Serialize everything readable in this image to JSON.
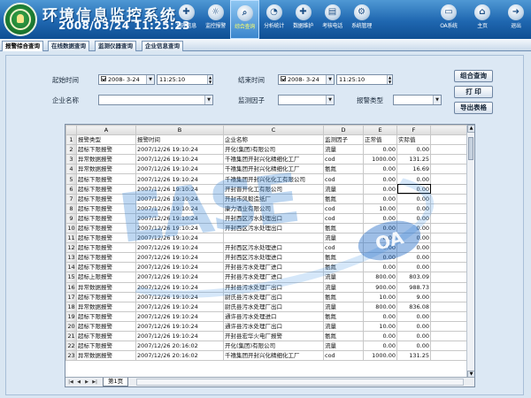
{
  "header": {
    "system_title": "环境信息监控系统",
    "datetime": "2008/03/24 11:25:23",
    "nav_main": [
      {
        "label": "地理信息",
        "icon": "map-icon",
        "glyph": "✚"
      },
      {
        "label": "监控报警",
        "icon": "alarm-icon",
        "glyph": "☼"
      },
      {
        "label": "综合查询",
        "icon": "query-icon",
        "glyph": "⌕",
        "active": true
      },
      {
        "label": "分析统计",
        "icon": "statistics-icon",
        "glyph": "◔"
      },
      {
        "label": "数据维护",
        "icon": "data-maintenance-icon",
        "glyph": "✚"
      },
      {
        "label": "考核电话",
        "icon": "phone-icon",
        "glyph": "▤"
      },
      {
        "label": "系统管理",
        "icon": "system-settings-icon",
        "glyph": "⚙"
      }
    ],
    "nav_right": [
      {
        "label": "OA系统",
        "icon": "computer-icon",
        "glyph": "▭"
      },
      {
        "label": "主页",
        "icon": "home-icon",
        "glyph": "⌂"
      },
      {
        "label": "退出",
        "icon": "exit-door-icon",
        "glyph": "➜"
      }
    ]
  },
  "tabs": [
    {
      "label": "报警综合查询",
      "active": true
    },
    {
      "label": "在线数据查询",
      "active": false
    },
    {
      "label": "监测仪器查询",
      "active": false
    },
    {
      "label": "企业信息查询",
      "active": false
    }
  ],
  "filters": {
    "start_time_label": "起始时间",
    "start_date": "2008- 3-24",
    "start_time": "11:25:10",
    "end_time_label": "结束时间",
    "end_date": "2008- 3-24",
    "end_time": "11:25:10",
    "company_label": "企业名称",
    "company_value": "",
    "factor_label": "监测因子",
    "factor_value": "",
    "alarm_type_label": "报警类型",
    "alarm_type_value": ""
  },
  "buttons": {
    "combined_query": "组合查询",
    "print": "打  印",
    "export": "导出表格"
  },
  "sheet": {
    "watermark": "EASE",
    "watermark_badge": "OA",
    "sheet_tab": "第1页",
    "columns": [
      "A",
      "B",
      "C",
      "D",
      "E",
      "F"
    ],
    "header_row": [
      "报警类型",
      "报警时间",
      "企业名称",
      "监测因子",
      "正常值",
      "实际值"
    ],
    "rows": [
      [
        "超标下限报警",
        "2007/12/26 19:10:24",
        "开化(集团)有限公司",
        "流量",
        "0.00",
        "0.00"
      ],
      [
        "异常数据报警",
        "2007/12/26 19:10:24",
        "千禧集团开封兴化精细化工厂",
        "cod",
        "1000.00",
        "131.25"
      ],
      [
        "异常数据报警",
        "2007/12/26 19:10:24",
        "千禧集团开封兴化精细化工厂",
        "氨氮",
        "0.00",
        "16.69"
      ],
      [
        "超标下限报警",
        "2007/12/26 19:10:24",
        "千禧集团开封兴化化工有限公司",
        "cod",
        "0.00",
        "0.00"
      ],
      [
        "超标下限报警",
        "2007/12/26 19:10:24",
        "开封晋开化工有限公司",
        "流量",
        "0.00",
        "0.00"
      ],
      [
        "超标下限报警",
        "2007/12/26 19:10:24",
        "开封市风毅造纸厂",
        "氨氮",
        "0.00",
        "0.00"
      ],
      [
        "超标下限报警",
        "2007/12/26 19:10:24",
        "康力酒业有限公司",
        "cod",
        "10.00",
        "0.00"
      ],
      [
        "超标下限报警",
        "2007/12/26 19:10:24",
        "开封西区污水处理出口",
        "cod",
        "0.00",
        "0.00"
      ],
      [
        "超标下限报警",
        "2007/12/26 19:10:24",
        "开封西区污水处理出口",
        "氨氮",
        "0.00",
        "0.00"
      ],
      [
        "超标下限报警",
        "2007/12/26 19:10:24",
        "",
        "流量",
        "0.00",
        "0.00"
      ],
      [
        "超标下限报警",
        "2007/12/26 19:10:24",
        "开封西区污水处理进口",
        "cod",
        "0.00",
        "0.00"
      ],
      [
        "超标下限报警",
        "2007/12/26 19:10:24",
        "开封西区污水处理进口",
        "氨氮",
        "0.00",
        "0.00"
      ],
      [
        "超标下限报警",
        "2007/12/26 19:10:24",
        "开封县污水处理厂进口",
        "氨氮",
        "0.00",
        "0.00"
      ],
      [
        "超标上限报警",
        "2007/12/26 19:10:24",
        "开封县污水处理厂进口",
        "流量",
        "800.00",
        "803.09"
      ],
      [
        "异常数据报警",
        "2007/12/26 19:10:24",
        "开封县污水处理厂出口",
        "流量",
        "900.00",
        "988.73"
      ],
      [
        "超标下限报警",
        "2007/12/26 19:10:24",
        "尉氏县污水处理厂出口",
        "氨氮",
        "10.00",
        "9.00"
      ],
      [
        "异常数据报警",
        "2007/12/26 19:10:24",
        "尉氏县污水处理厂出口",
        "流量",
        "800.00",
        "836.08"
      ],
      [
        "超标下限报警",
        "2007/12/26 19:10:24",
        "通许县污水处理进口",
        "氨氮",
        "0.00",
        "0.00"
      ],
      [
        "超标下限报警",
        "2007/12/26 19:10:24",
        "通许县污水处理厂出口",
        "流量",
        "10.00",
        "0.00"
      ],
      [
        "超标下限报警",
        "2007/12/26 19:10:24",
        "开封县宏华火电厂报警",
        "氨氮",
        "0.00",
        "0.00"
      ],
      [
        "超标下限报警",
        "2007/12/26 20:16:02",
        "开化(集团)有限公司",
        "流量",
        "0.00",
        "0.00"
      ],
      [
        "异常数据报警",
        "2007/12/26 20:16:02",
        "千禧集团开封兴化精细化工厂",
        "cod",
        "1000.00",
        "131.25"
      ]
    ]
  },
  "colors": {
    "header_blue": "#1f67b0",
    "panel_bg": "#dce8f4",
    "active_nav_label": "#ffff66",
    "number_blue": "#1f3fa0"
  }
}
